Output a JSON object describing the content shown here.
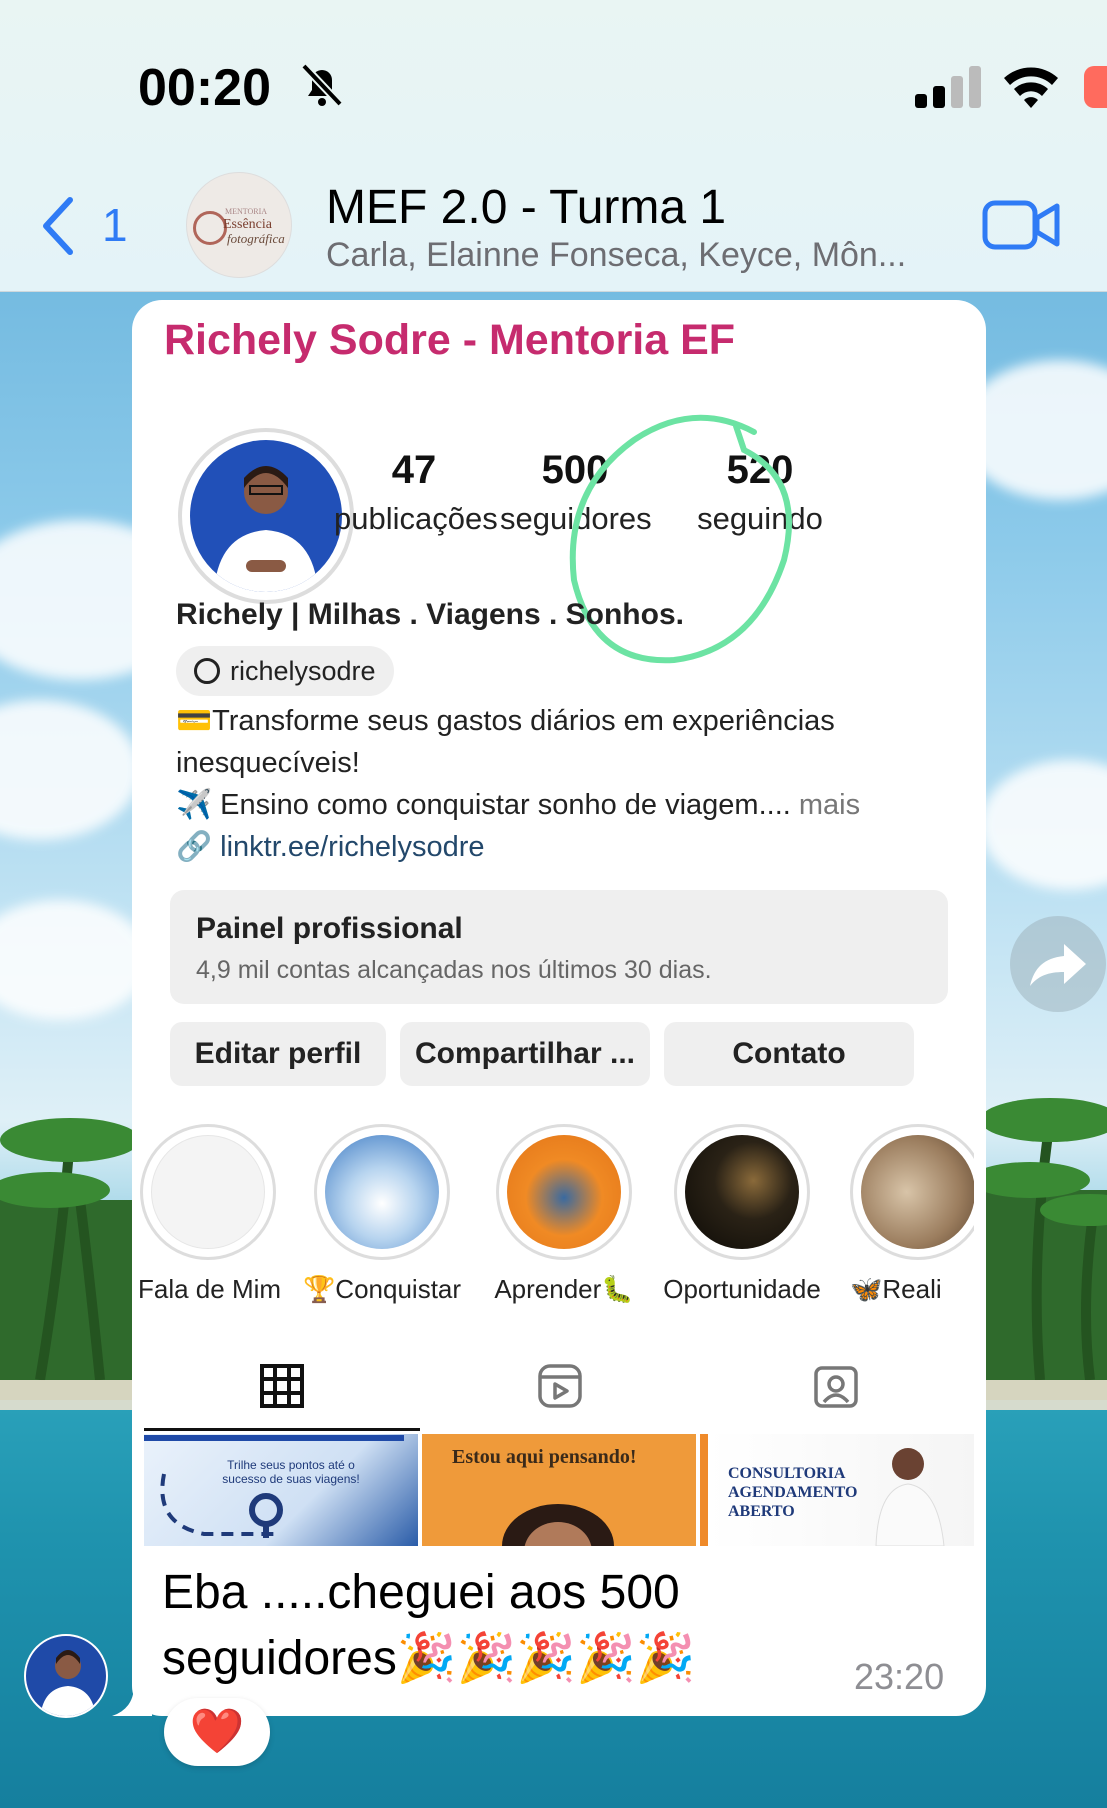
{
  "status_bar": {
    "time": "00:20"
  },
  "header": {
    "back_count": "1",
    "group_avatar_text": {
      "line1": "MENTORIA",
      "line2": "Essência",
      "line3": "fotográfica"
    },
    "title": "MEF 2.0 - Turma 1",
    "subtitle": "Carla, Elainne Fonseca, Keyce, Môn..."
  },
  "message": {
    "sender": "Richely Sodre - Mentoria EF",
    "text": "Eba .....cheguei aos 500 seguidores🎉🎉🎉🎉🎉",
    "time": "23:20",
    "reaction": "❤️"
  },
  "instagram": {
    "stats": [
      {
        "num": "47",
        "label": "publicações"
      },
      {
        "num": "500",
        "label": "seguidores"
      },
      {
        "num": "520",
        "label": "seguindo"
      }
    ],
    "name": "Richely | Milhas . Viagens . Sonhos.",
    "threads_handle": "richelysodre",
    "bio_line1": "💳Transforme seus gastos diários em experiências inesquecíveis!",
    "bio_line2": "✈️ Ensino como conquistar sonho de viagem....",
    "bio_more": " mais",
    "bio_link": "linktr.ee/richelysodre",
    "pro_title": "Painel profissional",
    "pro_sub": "4,9 mil contas alcançadas nos últimos 30 dias.",
    "buttons": [
      "Editar perfil",
      "Compartilhar ...",
      "Contato"
    ],
    "highlights": [
      "Fala de Mim",
      "🏆Conquistar",
      "Aprender🐛",
      "Oportunidade",
      "🦋Reali"
    ],
    "posts": [
      {
        "text": "Trilhe seus pontos até o sucesso de suas viagens!"
      },
      {
        "text": "Estou aqui pensando!"
      },
      {
        "text": "CONSULTORIA AGENDAMENTO ABERTO"
      }
    ]
  },
  "colors": {
    "accent_blue": "#2f7bf5",
    "sender_pink": "#c62b6e",
    "circle_green": "#6ce3a3"
  }
}
